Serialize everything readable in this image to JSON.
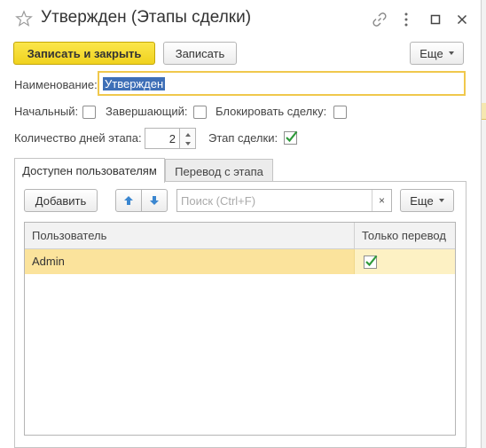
{
  "window": {
    "title": "Утвержден (Этапы сделки)"
  },
  "toolbar": {
    "save_close_label": "Записать и закрыть",
    "save_label": "Записать",
    "more_label": "Еще"
  },
  "form": {
    "name_label": "Наименование:",
    "name_value": "Утвержден",
    "initial_label": "Начальный:",
    "initial_checked": false,
    "final_label": "Завершающий:",
    "final_checked": false,
    "block_label": "Блокировать сделку:",
    "block_checked": false,
    "days_label": "Количество дней этапа:",
    "days_value": "2",
    "stage_label": "Этап сделки:",
    "stage_checked": true
  },
  "tabs": [
    {
      "label": "Доступен пользователям",
      "active": true
    },
    {
      "label": "Перевод с этапа",
      "active": false
    }
  ],
  "panel_toolbar": {
    "add_label": "Добавить",
    "search_placeholder": "Поиск (Ctrl+F)",
    "clear_symbol": "×",
    "more_label": "Еще"
  },
  "table": {
    "columns": [
      "Пользователь",
      "Только перевод"
    ],
    "rows": [
      {
        "user": "Admin",
        "transfer_only": true
      }
    ]
  },
  "colors": {
    "accent_yellow": "#f0d21e",
    "selection_blue": "#3e6fb7",
    "row_selected": "#fbe39c",
    "check_green": "#2e9a3a"
  }
}
